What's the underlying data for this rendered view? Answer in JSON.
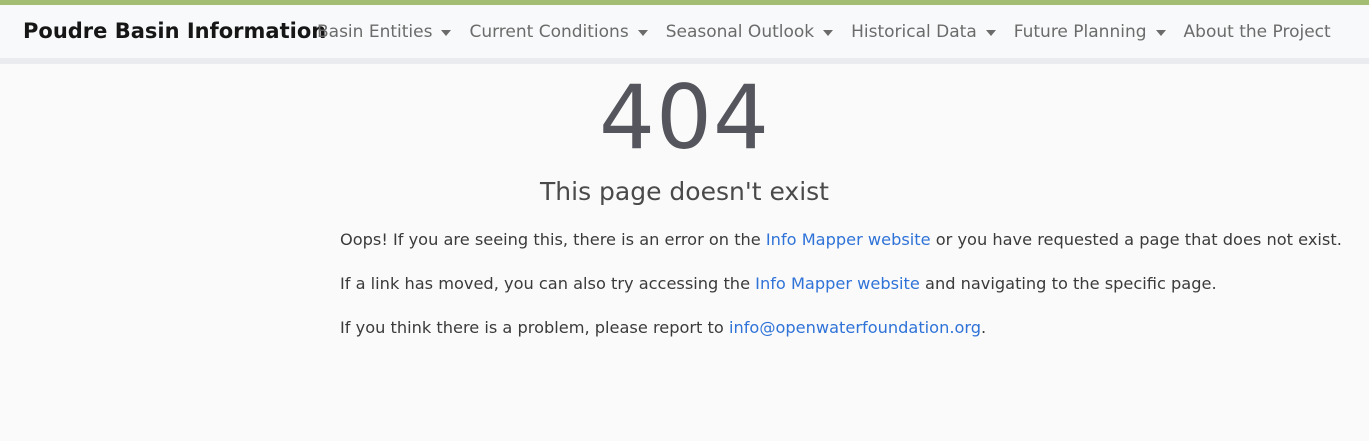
{
  "header": {
    "brand": "Poudre Basin Information",
    "nav": [
      {
        "label": "Basin Entities",
        "dropdown": true
      },
      {
        "label": "Current Conditions",
        "dropdown": true
      },
      {
        "label": "Seasonal Outlook",
        "dropdown": true
      },
      {
        "label": "Historical Data",
        "dropdown": true
      },
      {
        "label": "Future Planning",
        "dropdown": true
      },
      {
        "label": "About the Project",
        "dropdown": false
      }
    ]
  },
  "colors": {
    "accent_stripe": "#a3bd72",
    "link": "#2f73d8"
  },
  "error": {
    "code": "404",
    "title": "This page doesn't exist"
  },
  "messages": {
    "line1": {
      "before": "Oops! If you are seeing this, there is an error on the ",
      "link": "Info Mapper website",
      "after": " or you have requested a page that does not exist."
    },
    "line2": {
      "before": "If a link has moved, you can also try accessing the ",
      "link": "Info Mapper website",
      "after": " and navigating to the specific page."
    },
    "line3": {
      "before": "If you think there is a problem, please report to ",
      "link": "info@openwaterfoundation.org",
      "after": "."
    }
  }
}
